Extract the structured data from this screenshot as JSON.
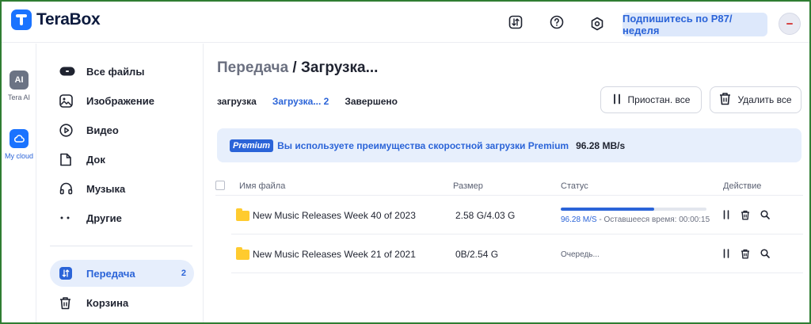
{
  "app": {
    "name": "TeraBox"
  },
  "topbar": {
    "subscribe_label": "Подпишитесь по Р87/неделя",
    "icons": [
      "transfer-icon",
      "help-icon",
      "settings-icon"
    ]
  },
  "rail": {
    "items": [
      {
        "badge": "AI",
        "label": "Tera AI"
      },
      {
        "badge": "",
        "label": "My cloud"
      }
    ]
  },
  "sidebar": {
    "items": [
      {
        "label": "Все файлы",
        "icon": "all-files-icon"
      },
      {
        "label": "Изображение",
        "icon": "image-icon"
      },
      {
        "label": "Видео",
        "icon": "video-icon"
      },
      {
        "label": "Док",
        "icon": "document-icon"
      },
      {
        "label": "Музыка",
        "icon": "music-icon"
      },
      {
        "label": "Другие",
        "icon": "other-icon"
      }
    ],
    "transfer": {
      "label": "Передача",
      "count": "2"
    },
    "trash": {
      "label": "Корзина"
    }
  },
  "main": {
    "title_crumb": "Передача",
    "title_sep": " / ",
    "title_current": "Загрузка...",
    "tabs": [
      {
        "label": "загрузка"
      },
      {
        "label": "Загрузка... 2"
      },
      {
        "label": "Завершено"
      }
    ],
    "pause_all_label": "Приостан. все",
    "delete_all_label": "Удалить все",
    "premium": {
      "tag": "Premium",
      "text": "Вы используете преимущества скоростной загрузки Premium",
      "speed": "96.28 MB/s"
    },
    "table": {
      "headers": {
        "name": "Имя файла",
        "size": "Размер",
        "status": "Статус",
        "action": "Действие"
      },
      "rows": [
        {
          "name": "New Music Releases Week 40 of 2023",
          "size": "2.58 G/4.03 G",
          "progress": 0.64,
          "speed": "96.28 M/S",
          "remaining": " - Оставшееся время: 00:00:15"
        },
        {
          "name": "New Music Releases Week 21 of 2021",
          "size": "0B/2.54 G",
          "status": "Очередь..."
        }
      ]
    }
  }
}
